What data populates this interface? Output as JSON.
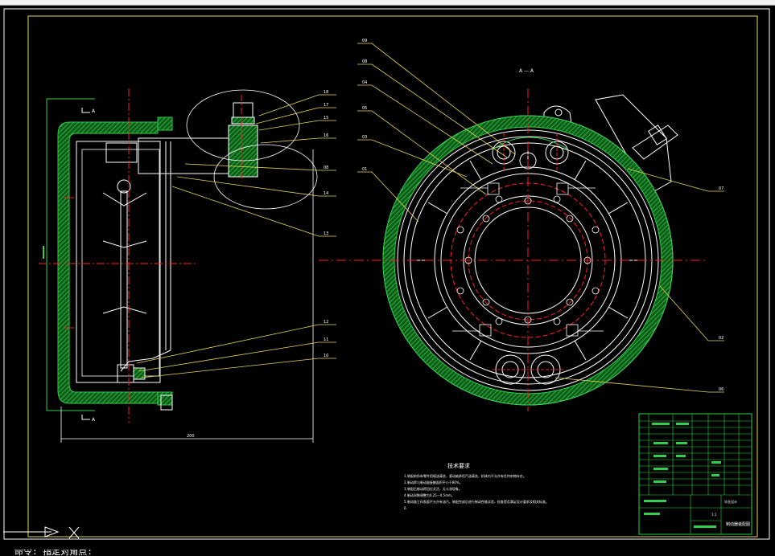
{
  "colors": {
    "background": "#000000",
    "frame": "#ffffff",
    "border_inner": "#e6d35a",
    "leader": "#e6d35a",
    "centerline": "#ff2020",
    "hatch": "#2fcf4a",
    "hatch_dark": "#0e5a18",
    "body": "#ffffff",
    "table_line": "#1fd63a"
  },
  "section_label": "A — A",
  "section_marks": {
    "top": "A",
    "bottom": "A"
  },
  "leaders_left": [
    "18",
    "17",
    "15",
    "16",
    "08",
    "14",
    "13",
    "12",
    "11",
    "10"
  ],
  "leaders_right": [
    "09",
    "08",
    "04",
    "05",
    "03",
    "01",
    "07",
    "02",
    "06"
  ],
  "dimension_bottom": "200",
  "tech_title": "技术要求",
  "tech_notes": [
    "1.装配前所有零件用煤油清洗，滚动轴承用汽油清洗，机体内不允许有任何杂物存在。",
    "2.制动蹄与制动鼓接触面积不小于80%。",
    "3.装配后制动蹄回位灵活，无卡滞现象。",
    "4.制动间隙调整为0.25—0.5mm。",
    "5.制动鼓工作表面不允许有油污，装配完成后进行制动性能试验，检查是否满足设计要求及相关标准。",
    "6."
  ],
  "title_block": {
    "drawing_name": "制动器装配图",
    "school": "毕业设计",
    "scale": "1:1"
  },
  "command_line": "命令: 指定对角点:",
  "icons": [
    "ucs-axis-icon"
  ]
}
